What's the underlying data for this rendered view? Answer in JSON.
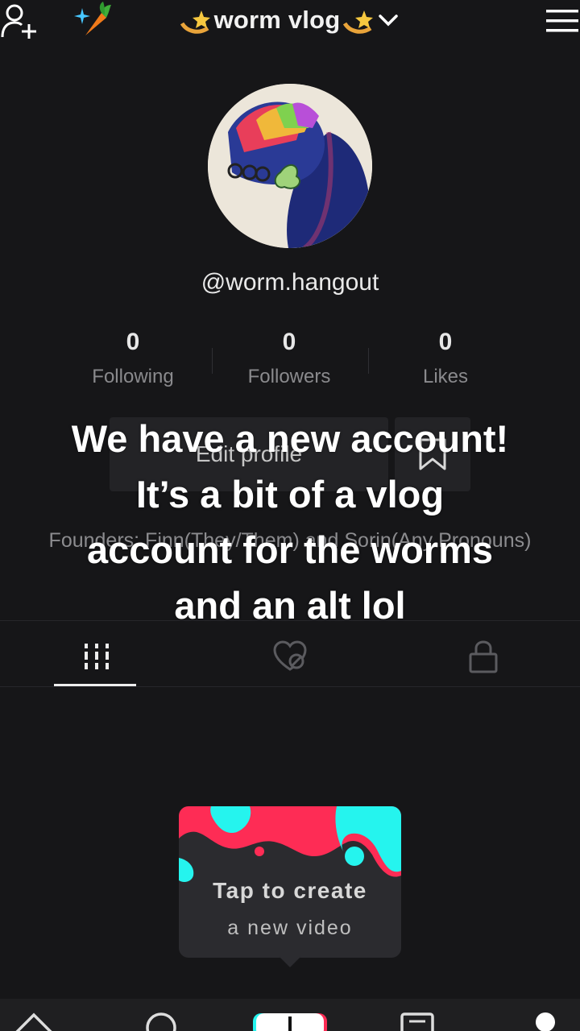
{
  "header": {
    "title": "worm vlog",
    "title_icon": "shooting-star-emoji",
    "add_user_icon": "add-user-icon",
    "badge_icon": "sparkle-carrot-emoji",
    "menu_icon": "hamburger-menu-icon"
  },
  "profile": {
    "handle": "@worm.hangout",
    "stats": [
      {
        "value": "0",
        "label": "Following"
      },
      {
        "value": "0",
        "label": "Followers"
      },
      {
        "value": "0",
        "label": "Likes"
      }
    ],
    "edit_label": "Edit profile",
    "bio": "Founders: Finn(They/Them) and Sorin(Any Pronouns)"
  },
  "caption": {
    "lines": [
      "We have a new account!",
      "It’s a bit of a vlog",
      "account for the worms",
      "and an alt lol"
    ]
  },
  "tabs": [
    "videos-grid-icon",
    "liked-videos-icon",
    "private-lock-icon"
  ],
  "create_card": {
    "line1": "Tap to create",
    "line2": "a new video"
  },
  "colors": {
    "background": "#161618",
    "tiktok_red": "#fe2c55",
    "tiktok_cyan": "#25f4ee"
  }
}
